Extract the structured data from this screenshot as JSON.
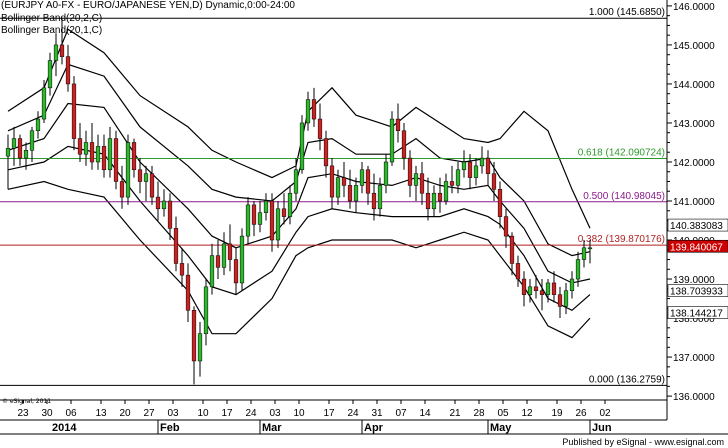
{
  "header": {
    "line1": "(EURJPY A0-FX - EURO/JAPANESE YEN,D) Dynamic,0:00-24:00",
    "line2": "Bollinger Band(20,2,C)",
    "line3": "Bollinger Band(20,1,C)"
  },
  "footer": {
    "copyright": "© eSignal, 2011",
    "published": "Published by eSignal - www.esignal.com"
  },
  "colors": {
    "up": "#2db82d",
    "down": "#cc2222",
    "bands": "#000000",
    "fib_618": "#2e9a2e",
    "fib_500": "#8b1a8b",
    "fib_382": "#b22222",
    "label_last": "#cc0000",
    "label_bg": "#ffffff"
  },
  "chart_data": {
    "type": "candlestick",
    "ylim": [
      135.9,
      146.1
    ],
    "y_ticks": [
      "136.0000",
      "137.0000",
      "138.0000",
      "139.0000",
      "140.0000",
      "141.0000",
      "142.0000",
      "143.0000",
      "144.0000",
      "145.0000",
      "146.0000"
    ],
    "x_ticks": [
      "23",
      "30",
      "06",
      "13",
      "20",
      "27",
      "03",
      "10",
      "17",
      "24",
      "03",
      "10",
      "17",
      "24",
      "31",
      "07",
      "14",
      "21",
      "28",
      "05",
      "12",
      "19",
      "26",
      "02"
    ],
    "x_month_labels": [
      "2014",
      "Feb",
      "Mar",
      "Apr",
      "May",
      "Jun"
    ],
    "fib_levels": [
      {
        "label": "1.000 (145.6850)",
        "value": 145.685,
        "color_key": "bands"
      },
      {
        "label": "0.618 (142.090724)",
        "value": 142.0907,
        "color_key": "fib_618"
      },
      {
        "label": "0.500 (140.98045)",
        "value": 140.98045,
        "color_key": "fib_500"
      },
      {
        "label": "0.382 (139.870176)",
        "value": 139.870176,
        "color_key": "fib_382"
      },
      {
        "label": "0.000 (136.2759)",
        "value": 136.2759,
        "color_key": "bands"
      }
    ],
    "right_labels": [
      {
        "text": "140.383083",
        "value": 140.383083,
        "style": "plain"
      },
      {
        "text": "139.840067",
        "value": 139.840067,
        "style": "last"
      },
      {
        "text": "138.703933",
        "value": 138.703933,
        "style": "plain"
      },
      {
        "text": "138.144217",
        "value": 138.144217,
        "style": "plain"
      }
    ],
    "candles": [
      [
        142.15,
        142.7,
        141.3,
        142.35
      ],
      [
        142.35,
        142.9,
        141.9,
        142.6
      ],
      [
        142.6,
        142.7,
        141.9,
        142.1
      ],
      [
        142.1,
        142.5,
        141.8,
        142.3
      ],
      [
        142.3,
        142.9,
        142.0,
        142.8
      ],
      [
        142.8,
        143.3,
        142.6,
        143.1
      ],
      [
        143.1,
        144.1,
        143.0,
        143.9
      ],
      [
        143.9,
        144.8,
        143.7,
        144.6
      ],
      [
        144.6,
        145.3,
        144.2,
        145.0
      ],
      [
        145.0,
        145.7,
        144.5,
        144.7
      ],
      [
        144.7,
        145.0,
        143.8,
        144.0
      ],
      [
        144.0,
        144.2,
        142.3,
        142.6
      ],
      [
        142.6,
        143.0,
        142.0,
        142.2
      ],
      [
        142.2,
        142.8,
        141.9,
        142.5
      ],
      [
        142.5,
        143.0,
        141.8,
        142.0
      ],
      [
        142.0,
        142.7,
        141.8,
        142.4
      ],
      [
        142.4,
        142.7,
        141.6,
        141.8
      ],
      [
        141.8,
        142.9,
        141.6,
        142.6
      ],
      [
        142.6,
        142.8,
        141.3,
        141.5
      ],
      [
        141.5,
        141.9,
        140.8,
        141.1
      ],
      [
        141.1,
        142.7,
        140.9,
        142.5
      ],
      [
        142.5,
        142.6,
        141.6,
        141.8
      ],
      [
        141.8,
        142.1,
        141.2,
        141.5
      ],
      [
        141.5,
        141.9,
        141.0,
        141.7
      ],
      [
        141.7,
        141.9,
        140.9,
        141.1
      ],
      [
        141.1,
        141.5,
        140.5,
        140.8
      ],
      [
        140.8,
        141.3,
        140.6,
        141.0
      ],
      [
        141.0,
        141.2,
        140.0,
        140.3
      ],
      [
        140.3,
        140.6,
        139.2,
        139.4
      ],
      [
        139.4,
        139.8,
        138.8,
        139.1
      ],
      [
        139.1,
        139.4,
        137.9,
        138.2
      ],
      [
        138.2,
        138.3,
        136.3,
        136.9
      ],
      [
        136.9,
        137.9,
        136.5,
        137.6
      ],
      [
        137.6,
        139.0,
        137.3,
        138.8
      ],
      [
        138.8,
        139.9,
        138.6,
        139.6
      ],
      [
        139.6,
        140.0,
        139.0,
        139.3
      ],
      [
        139.3,
        140.2,
        139.1,
        139.9
      ],
      [
        139.9,
        140.4,
        139.2,
        139.5
      ],
      [
        139.5,
        139.8,
        138.6,
        138.9
      ],
      [
        138.9,
        140.3,
        138.7,
        140.1
      ],
      [
        140.1,
        141.1,
        139.9,
        140.9
      ],
      [
        140.9,
        141.0,
        140.1,
        140.4
      ],
      [
        140.4,
        141.0,
        140.2,
        140.7
      ],
      [
        140.7,
        141.2,
        140.5,
        141.0
      ],
      [
        141.0,
        141.2,
        139.7,
        140.0
      ],
      [
        140.0,
        141.0,
        139.8,
        140.8
      ],
      [
        140.8,
        141.2,
        140.4,
        140.6
      ],
      [
        140.6,
        141.4,
        140.4,
        141.2
      ],
      [
        141.2,
        142.1,
        141.0,
        141.8
      ],
      [
        141.8,
        143.2,
        141.7,
        143.0
      ],
      [
        143.0,
        143.8,
        142.8,
        143.6
      ],
      [
        143.6,
        143.9,
        142.9,
        143.1
      ],
      [
        143.1,
        143.5,
        142.3,
        142.6
      ],
      [
        142.6,
        142.8,
        141.6,
        141.9
      ],
      [
        141.9,
        142.1,
        140.8,
        141.1
      ],
      [
        141.1,
        141.8,
        140.9,
        141.6
      ],
      [
        141.6,
        142.0,
        141.1,
        141.4
      ],
      [
        141.4,
        141.8,
        140.8,
        141.0
      ],
      [
        141.0,
        141.6,
        140.7,
        141.4
      ],
      [
        141.4,
        142.0,
        141.2,
        141.8
      ],
      [
        141.8,
        141.9,
        140.9,
        141.2
      ],
      [
        141.2,
        141.7,
        140.5,
        140.8
      ],
      [
        140.8,
        141.6,
        140.6,
        141.4
      ],
      [
        141.4,
        142.2,
        141.2,
        142.0
      ],
      [
        142.0,
        143.3,
        141.9,
        143.1
      ],
      [
        143.1,
        143.5,
        142.5,
        142.8
      ],
      [
        142.8,
        143.0,
        141.8,
        142.1
      ],
      [
        142.1,
        142.3,
        141.1,
        141.4
      ],
      [
        141.4,
        141.9,
        141.0,
        141.7
      ],
      [
        141.7,
        142.0,
        140.9,
        141.2
      ],
      [
        141.2,
        141.6,
        140.5,
        140.8
      ],
      [
        140.8,
        141.4,
        140.6,
        141.2
      ],
      [
        141.2,
        141.6,
        140.7,
        141.0
      ],
      [
        141.0,
        141.7,
        140.9,
        141.5
      ],
      [
        141.5,
        141.9,
        141.2,
        141.4
      ],
      [
        141.4,
        142.0,
        141.2,
        141.8
      ],
      [
        141.8,
        142.3,
        141.6,
        142.0
      ],
      [
        142.0,
        142.2,
        141.3,
        141.6
      ],
      [
        141.6,
        142.1,
        141.4,
        141.9
      ],
      [
        141.9,
        142.4,
        141.7,
        142.1
      ],
      [
        142.1,
        142.3,
        141.4,
        141.7
      ],
      [
        141.7,
        142.0,
        141.0,
        141.3
      ],
      [
        141.3,
        141.5,
        140.3,
        140.6
      ],
      [
        140.6,
        140.8,
        139.8,
        140.1
      ],
      [
        140.1,
        140.2,
        139.1,
        139.4
      ],
      [
        139.4,
        139.6,
        138.8,
        139.0
      ],
      [
        139.0,
        139.2,
        138.3,
        138.6
      ],
      [
        138.6,
        139.0,
        138.4,
        138.8
      ],
      [
        138.8,
        139.1,
        138.5,
        138.7
      ],
      [
        138.7,
        139.0,
        138.2,
        138.6
      ],
      [
        138.6,
        139.0,
        138.4,
        138.9
      ],
      [
        138.9,
        139.2,
        138.4,
        138.6
      ],
      [
        138.6,
        138.8,
        138.0,
        138.3
      ],
      [
        138.3,
        138.9,
        138.1,
        138.7
      ],
      [
        138.7,
        139.2,
        138.5,
        139.0
      ],
      [
        139.0,
        139.7,
        138.8,
        139.5
      ],
      [
        139.5,
        140.0,
        139.3,
        139.8
      ],
      [
        139.8,
        140.0,
        139.4,
        139.8
      ]
    ],
    "bands": {
      "outer_upper": [
        [
          0,
          143.3
        ],
        [
          6,
          143.9
        ],
        [
          10,
          145.4
        ],
        [
          16,
          144.8
        ],
        [
          22,
          143.7
        ],
        [
          30,
          142.9
        ],
        [
          34,
          142.3
        ],
        [
          38,
          142.0
        ],
        [
          44,
          141.6
        ],
        [
          48,
          141.9
        ],
        [
          50,
          143.3
        ],
        [
          54,
          143.9
        ],
        [
          58,
          143.2
        ],
        [
          64,
          142.9
        ],
        [
          68,
          143.4
        ],
        [
          72,
          143.0
        ],
        [
          76,
          142.6
        ],
        [
          80,
          142.5
        ],
        [
          82,
          142.6
        ],
        [
          86,
          143.3
        ],
        [
          90,
          142.8
        ],
        [
          94,
          141.3
        ],
        [
          97,
          140.3
        ]
      ],
      "inner_upper": [
        [
          0,
          142.8
        ],
        [
          6,
          143.2
        ],
        [
          10,
          144.5
        ],
        [
          16,
          144.2
        ],
        [
          22,
          142.9
        ],
        [
          30,
          141.9
        ],
        [
          34,
          141.3
        ],
        [
          38,
          141.1
        ],
        [
          44,
          141.0
        ],
        [
          48,
          141.5
        ],
        [
          50,
          142.5
        ],
        [
          54,
          142.6
        ],
        [
          58,
          142.2
        ],
        [
          64,
          142.2
        ],
        [
          68,
          142.6
        ],
        [
          72,
          142.1
        ],
        [
          76,
          142.0
        ],
        [
          80,
          142.1
        ],
        [
          82,
          141.6
        ],
        [
          86,
          141.0
        ],
        [
          90,
          139.9
        ],
        [
          94,
          139.6
        ],
        [
          97,
          139.7
        ]
      ],
      "middle": [
        [
          0,
          142.3
        ],
        [
          6,
          142.6
        ],
        [
          10,
          143.5
        ],
        [
          16,
          143.4
        ],
        [
          22,
          142.0
        ],
        [
          30,
          140.8
        ],
        [
          34,
          140.1
        ],
        [
          38,
          139.8
        ],
        [
          44,
          140.1
        ],
        [
          48,
          140.8
        ],
        [
          50,
          141.6
        ],
        [
          54,
          141.7
        ],
        [
          58,
          141.5
        ],
        [
          64,
          141.4
        ],
        [
          68,
          141.6
        ],
        [
          72,
          141.4
        ],
        [
          76,
          141.3
        ],
        [
          80,
          141.4
        ],
        [
          82,
          141.0
        ],
        [
          86,
          140.3
        ],
        [
          90,
          139.2
        ],
        [
          94,
          138.9
        ],
        [
          97,
          139.0
        ]
      ],
      "inner_lower": [
        [
          0,
          141.8
        ],
        [
          6,
          142.0
        ],
        [
          10,
          142.4
        ],
        [
          16,
          142.2
        ],
        [
          22,
          141.0
        ],
        [
          30,
          139.6
        ],
        [
          34,
          138.8
        ],
        [
          38,
          138.6
        ],
        [
          44,
          139.2
        ],
        [
          48,
          140.2
        ],
        [
          50,
          140.6
        ],
        [
          54,
          140.8
        ],
        [
          58,
          140.7
        ],
        [
          64,
          140.6
        ],
        [
          68,
          140.6
        ],
        [
          72,
          140.6
        ],
        [
          76,
          140.8
        ],
        [
          80,
          140.6
        ],
        [
          82,
          140.4
        ],
        [
          86,
          139.6
        ],
        [
          90,
          138.5
        ],
        [
          94,
          138.2
        ],
        [
          97,
          138.6
        ]
      ],
      "outer_lower": [
        [
          0,
          141.3
        ],
        [
          6,
          141.5
        ],
        [
          10,
          141.3
        ],
        [
          16,
          141.1
        ],
        [
          22,
          140.0
        ],
        [
          30,
          138.7
        ],
        [
          34,
          137.6
        ],
        [
          38,
          137.6
        ],
        [
          44,
          138.5
        ],
        [
          48,
          139.6
        ],
        [
          50,
          139.8
        ],
        [
          54,
          140.0
        ],
        [
          58,
          140.0
        ],
        [
          64,
          140.0
        ],
        [
          68,
          139.8
        ],
        [
          72,
          140.0
        ],
        [
          76,
          140.2
        ],
        [
          80,
          140.0
        ],
        [
          82,
          139.6
        ],
        [
          86,
          138.8
        ],
        [
          90,
          137.8
        ],
        [
          94,
          137.5
        ],
        [
          97,
          138.0
        ]
      ]
    }
  }
}
